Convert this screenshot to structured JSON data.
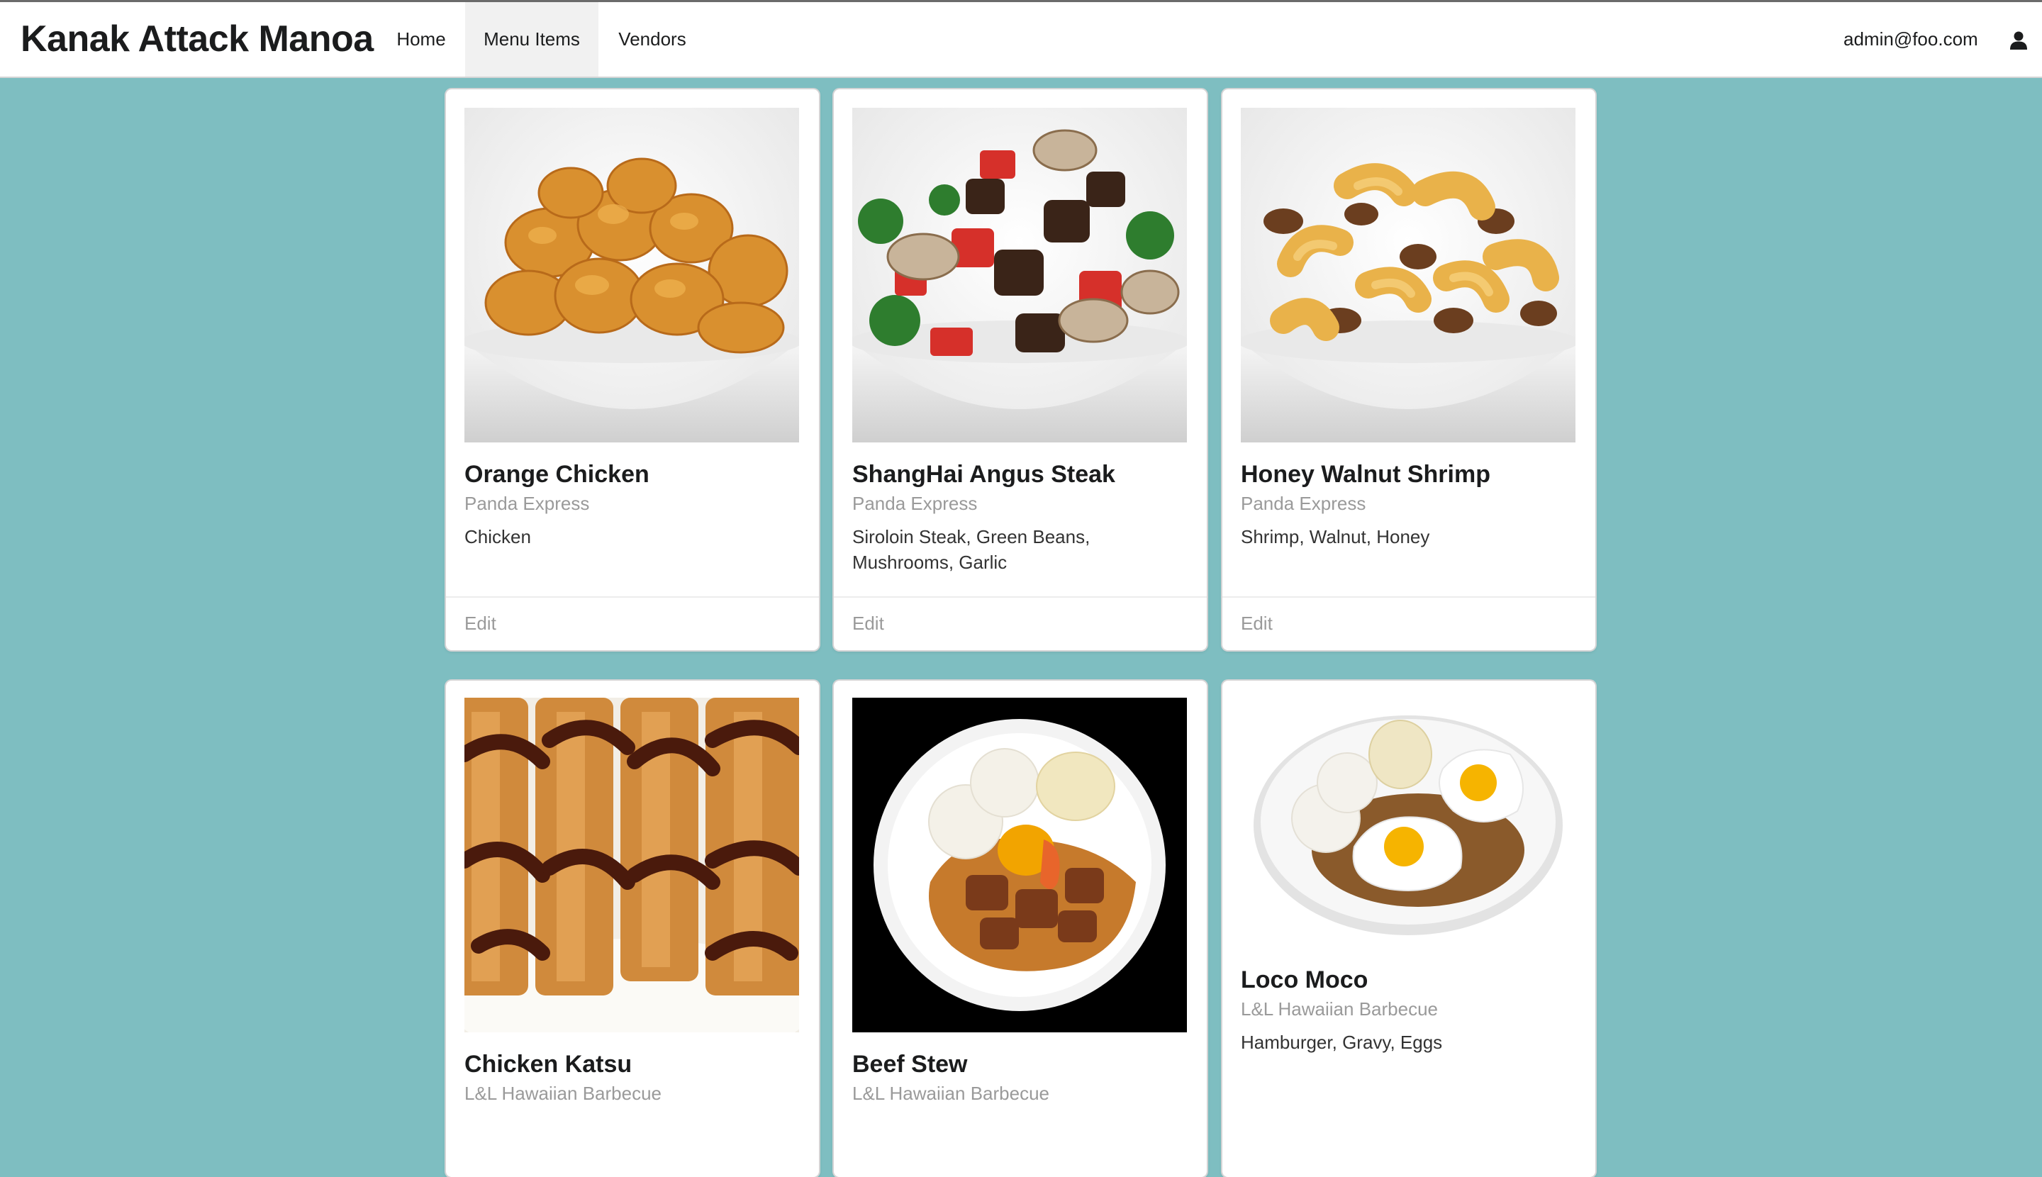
{
  "navbar": {
    "brand": "Kanak Attack Manoa",
    "links": [
      {
        "label": "Home",
        "active": false
      },
      {
        "label": "Menu Items",
        "active": true
      },
      {
        "label": "Vendors",
        "active": false
      }
    ],
    "user": "admin@foo.com",
    "user_icon": "user-icon"
  },
  "menu_items": [
    {
      "name": "Orange Chicken",
      "vendor": "Panda Express",
      "ingredients": "Chicken",
      "edit": "Edit"
    },
    {
      "name": "ShangHai Angus Steak",
      "vendor": "Panda Express",
      "ingredients": "Siroloin Steak, Green Beans, Mushrooms, Garlic",
      "edit": "Edit"
    },
    {
      "name": "Honey Walnut Shrimp",
      "vendor": "Panda Express",
      "ingredients": "Shrimp, Walnut, Honey",
      "edit": "Edit"
    },
    {
      "name": "Chicken Katsu",
      "vendor": "L&L Hawaiian Barbecue"
    },
    {
      "name": "Beef Stew",
      "vendor": "L&L Hawaiian Barbecue"
    },
    {
      "name": "Loco Moco",
      "vendor": "L&L Hawaiian Barbecue",
      "ingredients": "Hamburger, Gravy, Eggs"
    }
  ],
  "colors": {
    "background": "#7ebec1",
    "navbar": "#ffffff",
    "active_nav": "#f1f1f1",
    "muted_text": "#9a9a9a"
  }
}
